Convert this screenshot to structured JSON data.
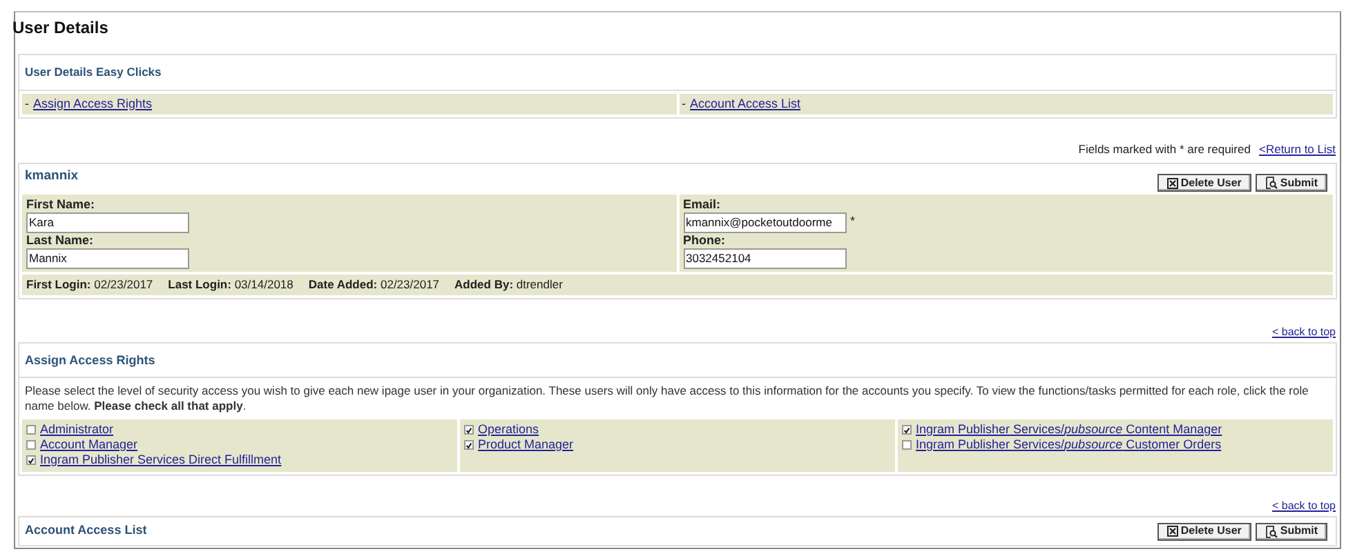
{
  "page_title": "User Details",
  "easy_clicks": {
    "title": "User Details Easy Clicks",
    "links": [
      {
        "prefix": "-",
        "label": "Assign Access Rights"
      },
      {
        "prefix": "-",
        "label": "Account Access List"
      }
    ]
  },
  "required_note": "Fields marked with * are required",
  "return_link": "<Return to List",
  "user": {
    "username": "kmannix",
    "buttons": [
      {
        "kind": "delete",
        "label": "Delete User"
      },
      {
        "kind": "submit",
        "label": "Submit"
      }
    ],
    "fields": [
      {
        "label": "First Name:",
        "value": "Kara"
      },
      {
        "label": "Email:",
        "value": "kmannix@pocketoutdoorme",
        "marker": "*"
      },
      {
        "label": "Last Name:",
        "value": "Mannix"
      },
      {
        "label": "Phone:",
        "value": "3032452104"
      }
    ],
    "info": [
      {
        "label": "First Login:",
        "value": "02/23/2017"
      },
      {
        "label": "Last Login:",
        "value": "03/14/2018"
      },
      {
        "label": "Date Added:",
        "value": "02/23/2017"
      },
      {
        "label": "Added By:",
        "value": "dtrendler"
      }
    ]
  },
  "back_to_top": [
    "< back to top",
    "< back to top"
  ],
  "access_rights": {
    "title": "Assign Access Rights",
    "description": "Please select the level of security access you wish to give each new ipage user in your organization. These users will only have access to this information for the accounts you specify. To view the functions/tasks permitted for each role, click the role name below. **Please check all that apply**.",
    "columns": [
      [
        {
          "label": "Administrator",
          "checked": false
        },
        {
          "label": "Account Manager",
          "checked": false
        },
        {
          "label": "Ingram Publisher Services Direct Fulfillment",
          "checked": true
        }
      ],
      [
        {
          "label": "Operations",
          "checked": true
        },
        {
          "label": "Product Manager",
          "checked": true
        }
      ],
      [
        {
          "label": "Ingram Publisher Services/*pubsource* Content Manager",
          "checked": true
        },
        {
          "label": "Ingram Publisher Services/*pubsource* Customer Orders",
          "checked": false
        }
      ]
    ]
  },
  "account_access": {
    "title": "Account Access List",
    "buttons": [
      {
        "kind": "delete",
        "label": "Delete User"
      },
      {
        "kind": "submit",
        "label": "Submit"
      }
    ]
  }
}
